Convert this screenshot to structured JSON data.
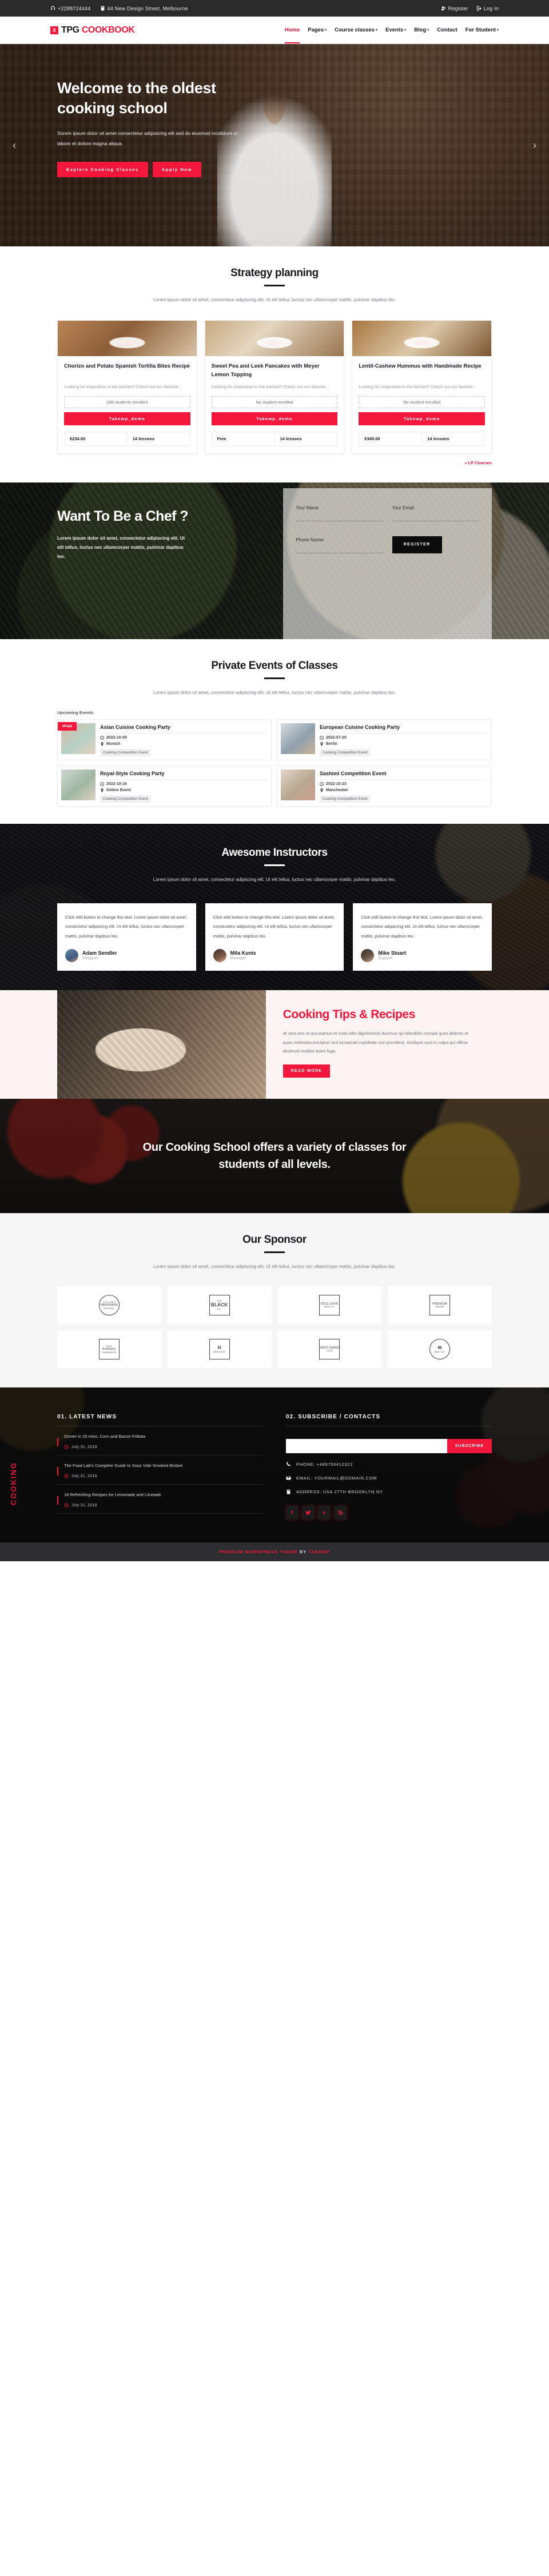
{
  "topbar": {
    "phone": "+2288724444",
    "address": "44 New Design Street, Melbourne",
    "register": "Register",
    "login": "Log In"
  },
  "brand": {
    "mark": "X",
    "name_1": "TPG ",
    "name_2": "COOKBOOK"
  },
  "nav": {
    "items": [
      {
        "label": "Home",
        "caret": "",
        "active": true
      },
      {
        "label": "Pages",
        "caret": "▾",
        "active": false
      },
      {
        "label": "Course classes",
        "caret": "▾",
        "active": false
      },
      {
        "label": "Events",
        "caret": "▾",
        "active": false
      },
      {
        "label": "Blog",
        "caret": "▾",
        "active": false
      },
      {
        "label": "Contact",
        "caret": "",
        "active": false
      },
      {
        "label": "For Student",
        "caret": "▾",
        "active": false
      }
    ]
  },
  "hero": {
    "title": "Welcome to the oldest cooking school",
    "text": "Sorem ipsum dolor sit amet consectetur adipisicing elit sed do eiusmod incididunt ut labore et dolore magna aliqua.",
    "btn_primary": "Explore Cooking Classes",
    "btn_secondary": "Apply Now",
    "prev": "‹",
    "next": "›"
  },
  "strategy": {
    "title": "Strategy planning",
    "subtitle": "Lorem ipsum dolor sit amet, consectetur adipiscing elit. Ut elit tellus, luctus nec ullamcorper mattis, pulvinar dapibus leo.",
    "courses": [
      {
        "title": "Chorizo and Potato Spanish Tortilla Bites Recipe",
        "desc": "Looking for inspiration in the kitchen? Check out our favorite...",
        "enrolled": "200 students enrolled",
        "cta": "Takewp_demo",
        "price": "€234.00",
        "lessons": "14 lessons"
      },
      {
        "title": "Sweet Pea and Leek Pancakes with Meyer Lemon Topping",
        "desc": "Looking for inspiration in the kitchen? Check out our favorite...",
        "enrolled": "No student enrolled",
        "cta": "Takewp_demo",
        "price": "Free",
        "lessons": "14 lessons"
      },
      {
        "title": "Lentil-Cashew Hummus with Handmade Recipe",
        "desc": "Looking for inspiration in the kitchen? Check out our favorite...",
        "enrolled": "No student enrolled",
        "cta": "Takewp_demo",
        "price": "€345.00",
        "lessons": "14 lessons"
      }
    ],
    "more_link": "» LP Courses"
  },
  "chef": {
    "title": "Want To Be a Chef ?",
    "text": "Lorem ipsum dolor sit amet, consectetur adipiscing elit. Ut elit tellus, luctus nec ullamcorper mattis, pulvinar dapibus leo.",
    "form": {
      "name_label": "Your Name",
      "name_value": "",
      "email_label": "Your Email",
      "email_value": "",
      "phone_label": "Phone Numer",
      "phone_value": "",
      "submit": "REGISTER"
    }
  },
  "events": {
    "title": "Private Events of Classes",
    "subtitle": "Lorem ipsum dolor sit amet, consectetur adipiscing elit. Ut elit tellus, luctus nec ullamcorper mattis, pulvinar dapibus leo.",
    "upcoming_label": "Upcoming Events",
    "paid_badge": "#Paid",
    "items": [
      {
        "title": "Asian Cuisine Cooking Party",
        "date": "2022-10-09",
        "place": "Munich",
        "tag": "Cooking Competition Event",
        "paid": true
      },
      {
        "title": "European Cuisine Cooking Party",
        "date": "2022-07-20",
        "place": "Berlin",
        "tag": "Cooking Competition Event",
        "paid": false
      },
      {
        "title": "Royal-Style Cooking Party",
        "date": "2022-10-16",
        "place": "Online Event",
        "tag": "Cooking Competition Event",
        "paid": false
      },
      {
        "title": "Sashimi Competition Event",
        "date": "2022-10-23",
        "place": "Mancheater",
        "tag": "Cooking Competition Event",
        "paid": false
      }
    ]
  },
  "instructors": {
    "title": "Awesome Instructors",
    "subtitle": "Lorem ipsum dolor sit amet, consectetur adipiscing elit. Ut elit tellus, luctus nec ullamcorper mattis, pulvinar dapibus leo.",
    "cards": [
      {
        "text": "Click edit button to change this text. Lorem ipsum dolor sit amet, consectetur adipiscing elit. Ut elit tellus, luctus nec ullamcorper mattis, pulvinar dapibus leo.",
        "name": "Adam Sendler",
        "role": "Designer"
      },
      {
        "text": "Click edit button to change this text. Lorem ipsum dolor sit amet, consectetur adipiscing elit. Ut elit tellus, luctus nec ullamcorper mattis, pulvinar dapibus leo.",
        "name": "Mila Kunis",
        "role": "Manager"
      },
      {
        "text": "Click edit button to change this text. Lorem ipsum dolor sit amet, consectetur adipiscing elit. Ut elit tellus, luctus nec ullamcorper mattis, pulvinar dapibus leo.",
        "name": "Mike Stuart",
        "role": "Support"
      }
    ]
  },
  "tips": {
    "title": "Cooking Tips & Recipes",
    "text": "At vero eos et accusamus et iusto odio dignissimos ducimus qui blanditiis corrupti quos dolores et quas molestias excepturi sint occaecati cupiditate non provident, similique sunt in culpa qui officia deserunt mollitia animi fuga.",
    "button": "READ MORE"
  },
  "banner": {
    "text": "Our Cooking School offers a variety of classes for students of all levels."
  },
  "sponsors": {
    "title": "Our Sponsor",
    "subtitle": "Lorem ipsum dolor sit amet, consectetur adipiscing elit. Ut elit tellus, luctus nec ullamcorper mattis, pulvinar dapibus leo.",
    "logos": [
      {
        "top": "EST. 1987",
        "main": "HANDMADE",
        "bottom": "ORIGINAL",
        "shape": "round"
      },
      {
        "top": "THE",
        "main": "BLACK",
        "bottom": "CO.",
        "shape": "square"
      },
      {
        "top": "",
        "main": "EXCLUSIVE",
        "bottom": "QUALITY",
        "shape": "square"
      },
      {
        "top": "",
        "main": "PREMIUM",
        "bottom": "BRAND",
        "shape": "square"
      },
      {
        "top": "100%",
        "main": "Authentic",
        "bottom": "GUARANTEE",
        "shape": "square"
      },
      {
        "top": "",
        "main": "H",
        "bottom": "HERITAGE",
        "shape": "square"
      },
      {
        "top": "",
        "main": "GENTLEMAN",
        "bottom": "CLUB",
        "shape": "square"
      },
      {
        "top": "",
        "main": "✉",
        "bottom": "MAIL CO.",
        "shape": "round"
      }
    ]
  },
  "footer": {
    "vertical": "COOKING",
    "news_head": "01. LATEST NEWS",
    "news": [
      {
        "title": "Dinner in 20 mins: Corn and Bacon Frittata",
        "date": "July 31, 2018"
      },
      {
        "title": "The Food Lab's Complete Guide to Sous Vide Smoked Brisket",
        "date": "July 31, 2018"
      },
      {
        "title": "18 Refreshing Recipes for Lemonade and Limeade",
        "date": "July 31, 2018"
      }
    ],
    "sub_head": "02. SUBSCRIBE / CONTACTS",
    "sub_placeholder": "",
    "sub_value": "",
    "sub_button": "SUBSCRIBE",
    "contacts": [
      {
        "icon": "phone-icon",
        "text": "PHONE: +489756412322"
      },
      {
        "icon": "mail-icon",
        "text": "EMAIL: YOURMAIL@DOMAIN.COM"
      },
      {
        "icon": "book-icon",
        "text": "ADDRESS: USA 27TH BROOKLYN NY"
      }
    ],
    "socials": [
      "facebook-icon",
      "twitter-icon",
      "vimeo-icon",
      "rss-icon"
    ],
    "copyright_1": "PREMIUM WORDPRESS THEME ",
    "copyright_by": "BY ",
    "copyright_2": "TAKEWP"
  },
  "colors": {
    "accent": "#f5163b",
    "dark": "#17171c",
    "muted": "#7d7d85"
  }
}
